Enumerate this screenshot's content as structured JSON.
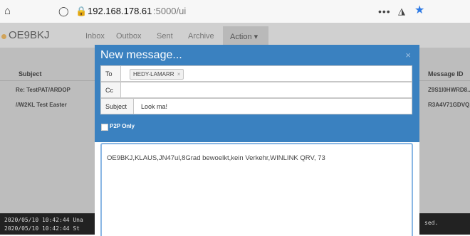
{
  "browser": {
    "url_host": "192.168.178.61",
    "url_path": ":5000/ui",
    "more_label": "•••"
  },
  "navbar": {
    "callsign": "OE9BKJ",
    "items": [
      "Inbox",
      "Outbox",
      "Sent",
      "Archive"
    ],
    "action_label": "Action ▾"
  },
  "table": {
    "columns": {
      "subject": "Subject",
      "message_id": "Message ID"
    },
    "rows": [
      {
        "subject": "Re: TestPAT/ARDOP",
        "message_id": "Z9S1I0HWRD8..."
      },
      {
        "subject": "//W2KL Test Easter",
        "message_id": "R3A4V71GDVQ..."
      }
    ]
  },
  "log": {
    "lines": [
      "2020/05/10 10:42:44 Una",
      "2020/05/10 10:42:44 St"
    ],
    "tail": "sed."
  },
  "modal": {
    "title": "New message...",
    "close_label": "×",
    "to_label": "To",
    "recipient": "HEDY-LAMARR",
    "recipient_remove": "×",
    "cc_label": "Cc",
    "subject_label": "Subject",
    "subject_value": "Look ma!",
    "p2p_label": "P2P Only",
    "p2p_checked": false,
    "body": "OE9BKJ,KLAUS,JN47ul,8Grad bewoelkt,kein Verkehr,WINLINK QRV, 73"
  },
  "icons": [
    "home-icon",
    "shield-icon",
    "insecure-lock-icon",
    "pocket-icon",
    "star-icon",
    "close-icon"
  ],
  "colors": {
    "modal_header": "#3a81c0",
    "star": "#2f7be5"
  }
}
